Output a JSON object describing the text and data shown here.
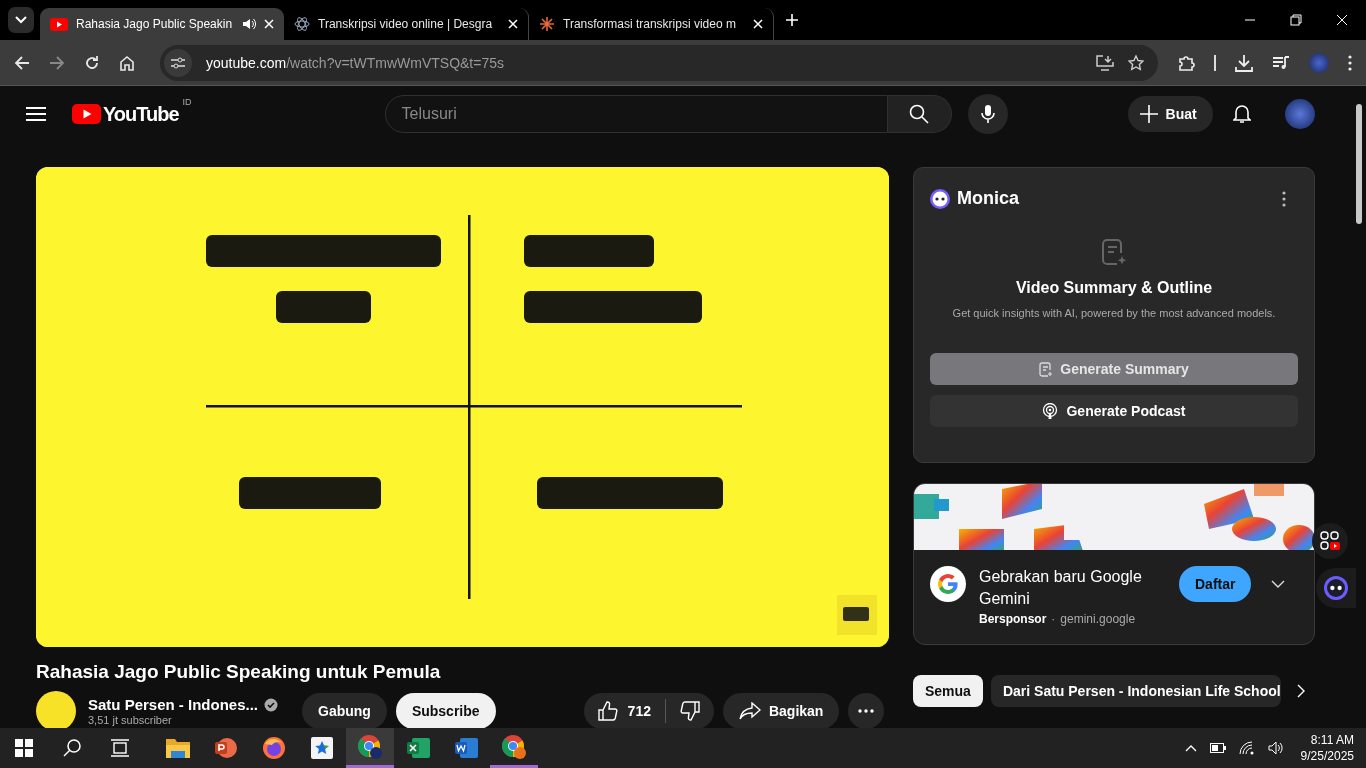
{
  "browser": {
    "tabs": [
      {
        "title": "Rahasia Jago Public Speakin",
        "selected": true,
        "audio": true,
        "kind": "youtube"
      },
      {
        "title": "Transkripsi video online | Desgra",
        "selected": false,
        "audio": false,
        "kind": "atom"
      },
      {
        "title": "Transformasi transkripsi video m",
        "selected": false,
        "audio": false,
        "kind": "burst"
      }
    ],
    "url_host": "youtube.com",
    "url_path": "/watch?v=tWTmwWmVTSQ&t=75s"
  },
  "youtube": {
    "logo": "YouTube",
    "country": "ID",
    "search": {
      "placeholder": "Telusuri"
    },
    "create_label": "Buat"
  },
  "video": {
    "kind": "picture",
    "title": "Rahasia Jago Public Speaking untuk Pemula",
    "channel": "Satu Persen - Indones...",
    "verified": true,
    "subscribers": "3,51 jt subscriber",
    "join": "Gabung",
    "subscribe": "Subscribe",
    "likes": "712",
    "share": "Bagikan"
  },
  "monica": {
    "name": "Monica",
    "heading": "Video Summary & Outline",
    "subtitle": "Get quick insights with AI, powered by the most advanced models.",
    "buttons": [
      {
        "label": "Generate Summary",
        "kind": "summary"
      },
      {
        "label": "Generate Podcast",
        "kind": "podcast"
      }
    ]
  },
  "ad": {
    "kind": "picture",
    "title": "Gebrakan baru Google Gemini",
    "sponsor": "Bersponsor",
    "separator": "·",
    "domain": "gemini.google",
    "action": "Daftar"
  },
  "chips": [
    {
      "label": "Semua",
      "selected": true
    },
    {
      "label": "Dari Satu Persen - Indonesian Life School",
      "selected": false
    }
  ],
  "taskbar": {
    "apps": [
      {
        "kind": "explorer",
        "selected": false,
        "running": false
      },
      {
        "kind": "powerpoint",
        "selected": false,
        "running": false
      },
      {
        "kind": "firefox",
        "selected": false,
        "running": false
      },
      {
        "kind": "star",
        "selected": false,
        "running": false
      },
      {
        "kind": "chrome",
        "selected": true,
        "running": true
      },
      {
        "kind": "excel",
        "selected": false,
        "running": false
      },
      {
        "kind": "word",
        "selected": false,
        "running": false
      },
      {
        "kind": "chrome-r",
        "selected": false,
        "running": true
      }
    ],
    "time": "8:11 AM",
    "date": "9/25/2025"
  }
}
